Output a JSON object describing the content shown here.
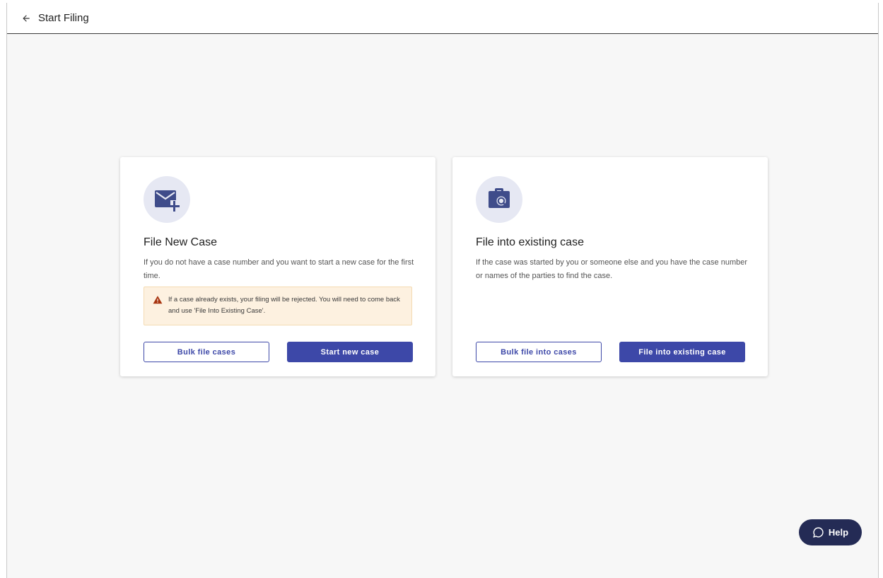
{
  "header": {
    "back_icon": "arrow-left-icon",
    "title": "Start Filing"
  },
  "cards": [
    {
      "icon": "mail-plus-icon",
      "title": "File New Case",
      "description": "If you do not have a case number and you want to start a new case for the first time.",
      "warning": {
        "icon": "warning-triangle-icon",
        "text": "If a case already exists, your filing will be rejected. You will need to come back and use 'File Into Existing Case'."
      },
      "secondary_button": "Bulk file cases",
      "primary_button": "Start new case"
    },
    {
      "icon": "briefcase-search-icon",
      "title": "File into existing case",
      "description": "If the case was started by you or someone else and you have the case number or names of the parties to find the case.",
      "secondary_button": "Bulk file into cases",
      "primary_button": "File into existing case"
    }
  ],
  "help": {
    "icon": "chat-bubble-icon",
    "label": "Help"
  },
  "colors": {
    "primary": "#3d48a8",
    "icon_circle": "#e6e8f3",
    "icon_fill": "#3f4c8a",
    "warning_bg": "#fdf1e0",
    "warning_icon": "#a8340f",
    "help_bg": "#242b55"
  }
}
